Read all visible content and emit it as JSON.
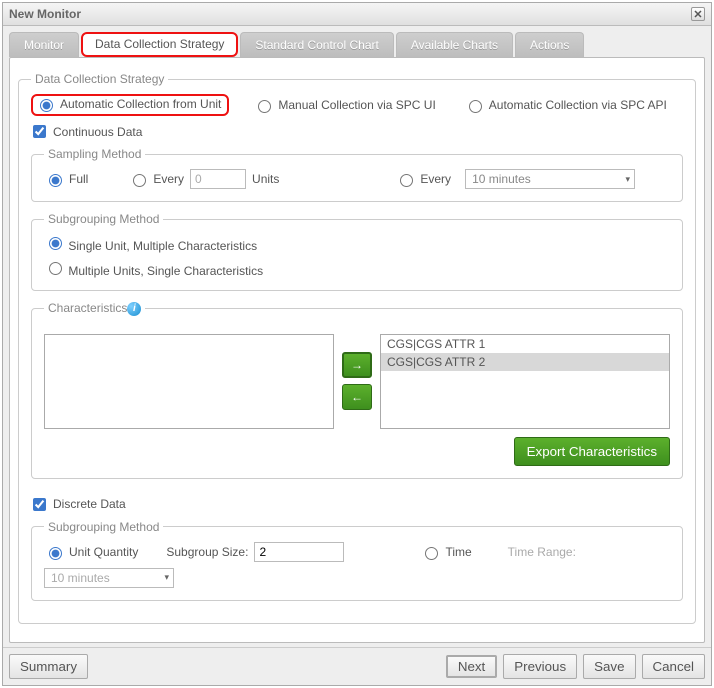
{
  "title": "New Monitor",
  "tabs": [
    "Monitor",
    "Data Collection Strategy",
    "Standard Control Chart",
    "Available Charts",
    "Actions"
  ],
  "active_tab_index": 1,
  "fieldset_title": "Data Collection Strategy",
  "collection_options": {
    "auto_unit": "Automatic Collection from Unit",
    "manual_spc": "Manual Collection via SPC UI",
    "auto_api": "Automatic Collection via SPC API"
  },
  "continuous_label": "Continuous Data",
  "sampling": {
    "legend": "Sampling Method",
    "full": "Full",
    "every_units": "Every",
    "units_label": "Units",
    "every_time": "Every",
    "every_units_value": "0",
    "time_value": "10 minutes"
  },
  "subgrouping1": {
    "legend": "Subgrouping Method",
    "single_multi": "Single Unit, Multiple Characteristics",
    "multi_single": "Multiple Units, Single Characteristics"
  },
  "characteristics": {
    "legend": "Characteristics",
    "left_items": [],
    "right_items": [
      "CGS|CGS ATTR 1",
      "CGS|CGS ATTR 2"
    ],
    "selected_right_index": 1,
    "export_label": "Export Characteristics"
  },
  "discrete_label": "Discrete Data",
  "subgrouping2": {
    "legend": "Subgrouping Method",
    "unit_qty": "Unit Quantity",
    "subgroup_size_label": "Subgroup Size:",
    "subgroup_size_value": "2",
    "time": "Time",
    "time_range_label": "Time Range:",
    "time_range_value": "10 minutes"
  },
  "buttons": {
    "summary": "Summary",
    "next": "Next",
    "previous": "Previous",
    "save": "Save",
    "cancel": "Cancel"
  }
}
